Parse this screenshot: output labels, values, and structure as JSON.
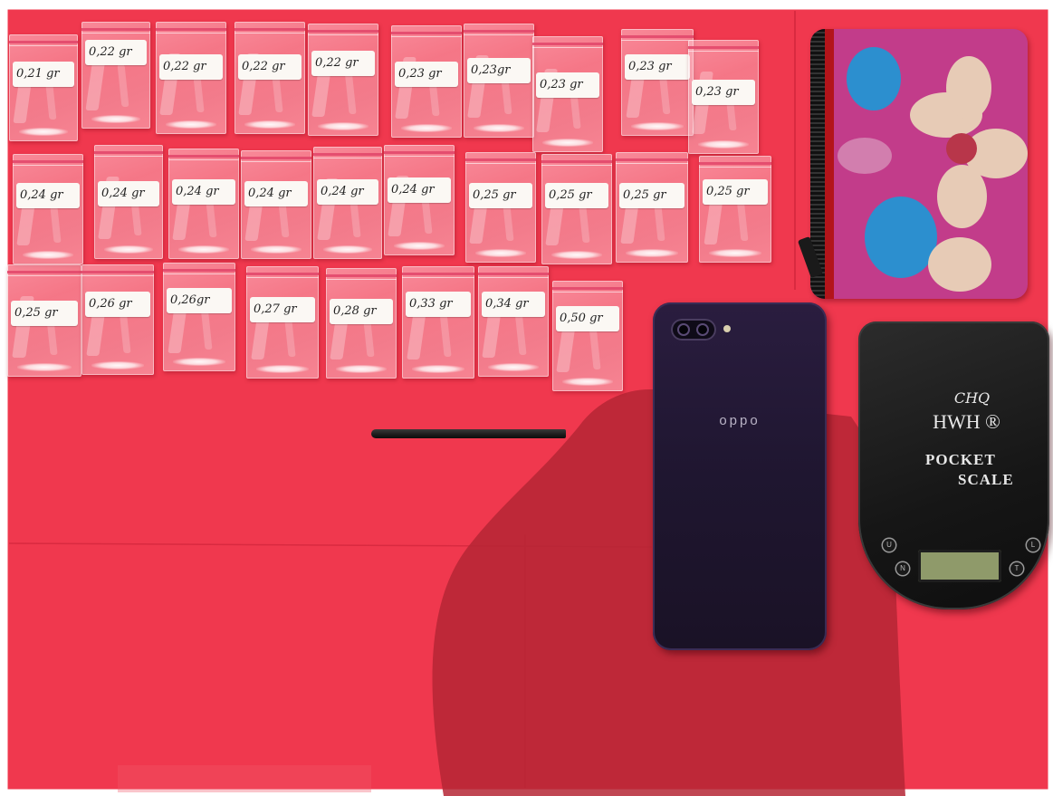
{
  "scene": {
    "background_color": "#f0384e",
    "shadow_color": "#b52635"
  },
  "bags": {
    "row1": [
      {
        "label": "0,21 gr"
      },
      {
        "label": "0,22 gr"
      },
      {
        "label": "0,22 gr"
      },
      {
        "label": "0,22 gr"
      },
      {
        "label": "0,22 gr"
      },
      {
        "label": "0,23 gr"
      },
      {
        "label": "0,23gr"
      },
      {
        "label": "0,23 gr"
      },
      {
        "label": "0,23 gr"
      },
      {
        "label": "0,23 gr"
      }
    ],
    "row2": [
      {
        "label": "0,24 gr"
      },
      {
        "label": "0,24 gr"
      },
      {
        "label": "0,24 gr"
      },
      {
        "label": "0,24 gr"
      },
      {
        "label": "0,24 gr"
      },
      {
        "label": "0,24 gr"
      },
      {
        "label": "0,25 gr"
      },
      {
        "label": "0,25 gr"
      },
      {
        "label": "0,25 gr"
      },
      {
        "label": "0,25 gr"
      }
    ],
    "row3": [
      {
        "label": "0,25 gr"
      },
      {
        "label": "0,26 gr"
      },
      {
        "label": "0,26gr"
      },
      {
        "label": "0,27 gr"
      },
      {
        "label": "0,28 gr"
      },
      {
        "label": "0,33 gr"
      },
      {
        "label": "0,34 gr"
      },
      {
        "label": "0,50 gr"
      }
    ]
  },
  "phone": {
    "brand": "oppo"
  },
  "scale": {
    "brand_line1": "CHQ",
    "brand_line2": "HWH ®",
    "brand_line3": "POCKET",
    "brand_line4": "SCALE",
    "button_top_left": "U",
    "button_bottom_left": "N",
    "button_bottom_right": "T",
    "button_top_right": "L"
  }
}
